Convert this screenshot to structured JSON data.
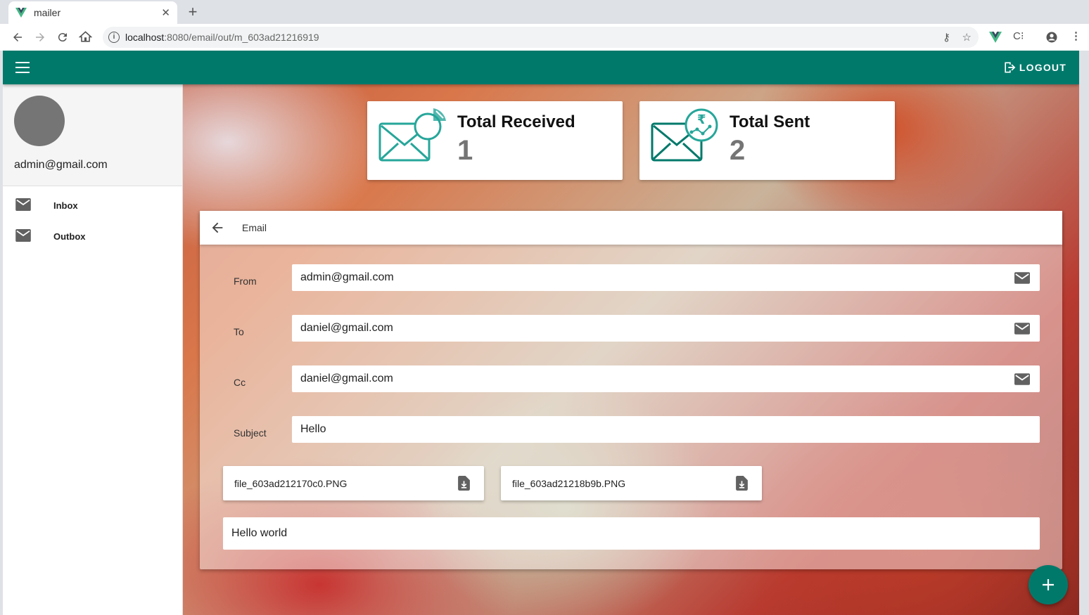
{
  "browser": {
    "tab_title": "mailer",
    "url_host": "localhost",
    "url_path": ":8080/email/out/m_603ad21216919"
  },
  "appbar": {
    "logout_label": "LOGOUT"
  },
  "drawer": {
    "user_email": "admin@gmail.com",
    "items": [
      {
        "label": "Inbox",
        "icon": "mail-icon"
      },
      {
        "label": "Outbox",
        "icon": "mail-icon"
      }
    ]
  },
  "stats": {
    "received": {
      "title": "Total Received",
      "value": "1"
    },
    "sent": {
      "title": "Total Sent",
      "value": "2"
    }
  },
  "email": {
    "header_title": "Email",
    "from_label": "From",
    "from_value": "admin@gmail.com",
    "to_label": "To",
    "to_value": "daniel@gmail.com",
    "cc_label": "Cc",
    "cc_value": "daniel@gmail.com",
    "subject_label": "Subject",
    "subject_value": "Hello",
    "attachments": [
      {
        "name": "file_603ad212170c0.PNG"
      },
      {
        "name": "file_603ad21218b9b.PNG"
      }
    ],
    "body": "Hello world"
  },
  "colors": {
    "primary": "#00796b",
    "accent_green": "#26a69a"
  }
}
